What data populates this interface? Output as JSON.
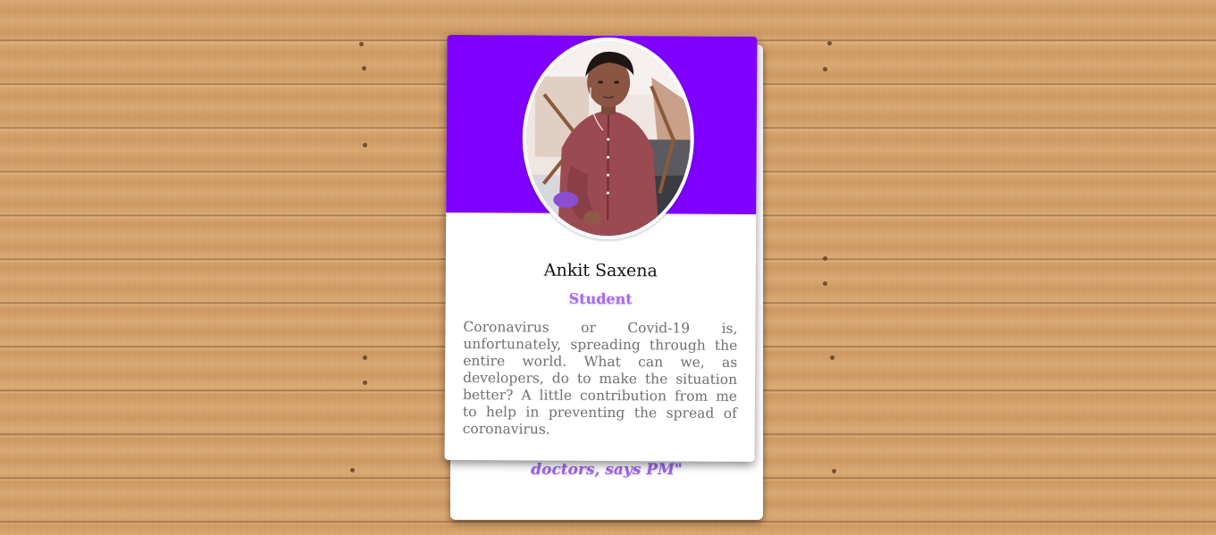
{
  "profile": {
    "name": "Ankit Saxena",
    "role": "Student",
    "bio": "Coronavirus or Covid-19 is, unfortunately, spreading through the entire world. What can we, as developers, do to make the situation better? A little contribution from me to help in preventing the spread of coronavirus.",
    "avatar_icon": "profile-photo"
  },
  "back_card": {
    "quote_fragment": "doctors, says PM\""
  },
  "colors": {
    "banner": "#8000ff",
    "role_accent": "#a56bf0",
    "card_background": "#ffffff",
    "wood_background": "#d7a46e"
  }
}
